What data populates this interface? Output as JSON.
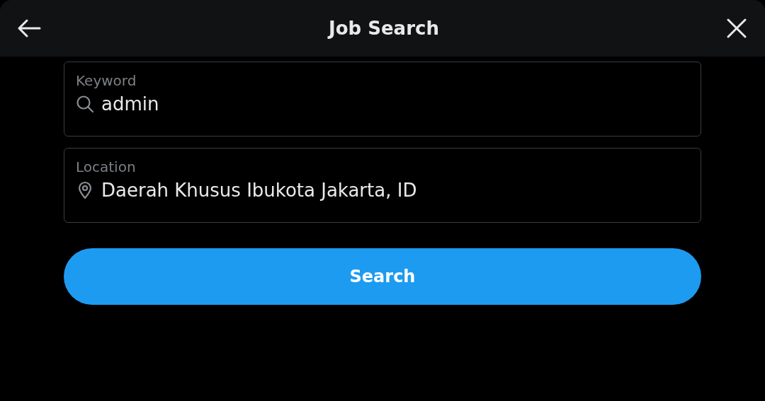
{
  "header": {
    "title": "Job Search"
  },
  "fields": [
    {
      "kind": "keyword",
      "label": "Keyword",
      "value": "admin"
    },
    {
      "kind": "location",
      "label": "Location",
      "value": "Daerah Khusus Ibukota Jakarta, ID"
    }
  ],
  "search_button": {
    "label": "Search"
  }
}
